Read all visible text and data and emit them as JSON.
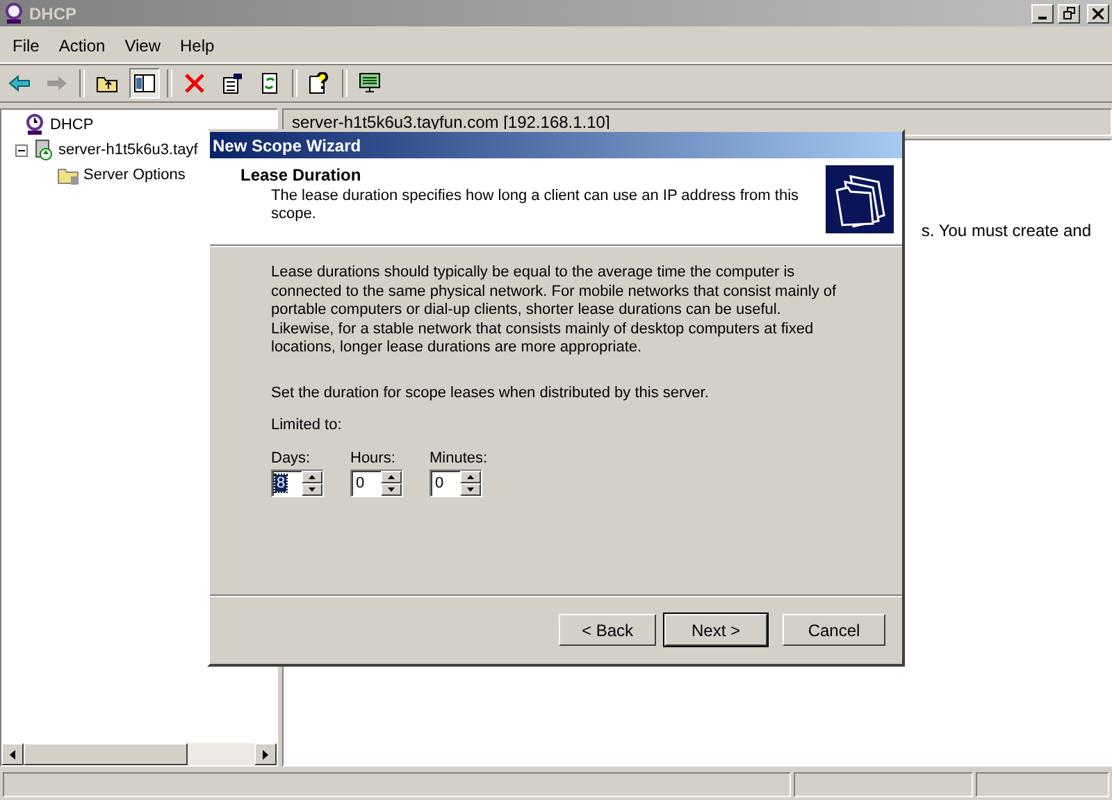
{
  "window": {
    "title": "DHCP"
  },
  "menu": [
    {
      "label": "File"
    },
    {
      "label": "Action"
    },
    {
      "label": "View"
    },
    {
      "label": "Help"
    }
  ],
  "tree": [
    {
      "label": "DHCP",
      "kind": "root",
      "children": [
        {
          "label": "server-h1t5k6u3.tayf",
          "kind": "server",
          "expanded": true,
          "children": [
            {
              "label": "Server Options",
              "kind": "folder"
            }
          ]
        }
      ]
    }
  ],
  "right_pane": {
    "header": "server-h1t5k6u3.tayfun.com [192.168.1.10]",
    "body_fragment": "s. You must create and"
  },
  "dialog": {
    "title": "New Scope Wizard",
    "heading": "Lease Duration",
    "subheading": "The lease duration specifies how long a client can use an IP address from this scope.",
    "paragraph": "Lease durations should typically be equal to the average time the computer is connected to the same physical network. For mobile networks that consist mainly of portable computers or dial-up clients, shorter lease durations can be useful. Likewise, for a stable network that consists mainly of desktop computers at fixed locations, longer lease durations are more appropriate.",
    "instruction": "Set the duration for scope leases when distributed by this server.",
    "limit_label": "Limited to:",
    "fields": [
      {
        "label": "Days:",
        "value": "8",
        "selected": true
      },
      {
        "label": "Hours:",
        "value": "0",
        "selected": false
      },
      {
        "label": "Minutes:",
        "value": "0",
        "selected": false
      }
    ],
    "buttons": [
      {
        "label": "< Back",
        "default": false
      },
      {
        "label": "Next >",
        "default": true
      },
      {
        "label": "Cancel",
        "default": false
      }
    ]
  }
}
